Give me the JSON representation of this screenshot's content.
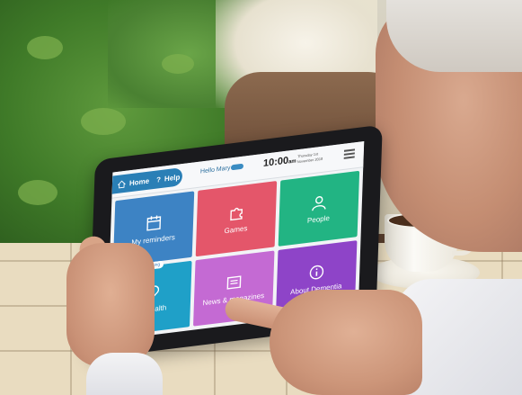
{
  "tablet": {
    "header": {
      "home_label": "Home",
      "help_label": "Help",
      "greeting": "Hello Mary",
      "time": "10:00",
      "ampm": "am",
      "date_line1": "Thursday 1st",
      "date_line2": "November 2018"
    },
    "tiles": [
      {
        "label": "My reminders",
        "color": "#3d83c4",
        "icon": "calendar-icon"
      },
      {
        "label": "Games",
        "color": "#e4566a",
        "icon": "puzzle-icon"
      },
      {
        "label": "People",
        "color": "#22b483",
        "icon": "person-icon"
      },
      {
        "label": "My health",
        "color": "#1fa0c8",
        "icon": "heart-icon",
        "badge": "Coming"
      },
      {
        "label": "News & magazines",
        "color": "#c46ad3",
        "icon": "newspaper-icon"
      },
      {
        "label": "About Dementia",
        "color": "#8e44c8",
        "icon": "info-icon"
      }
    ]
  }
}
